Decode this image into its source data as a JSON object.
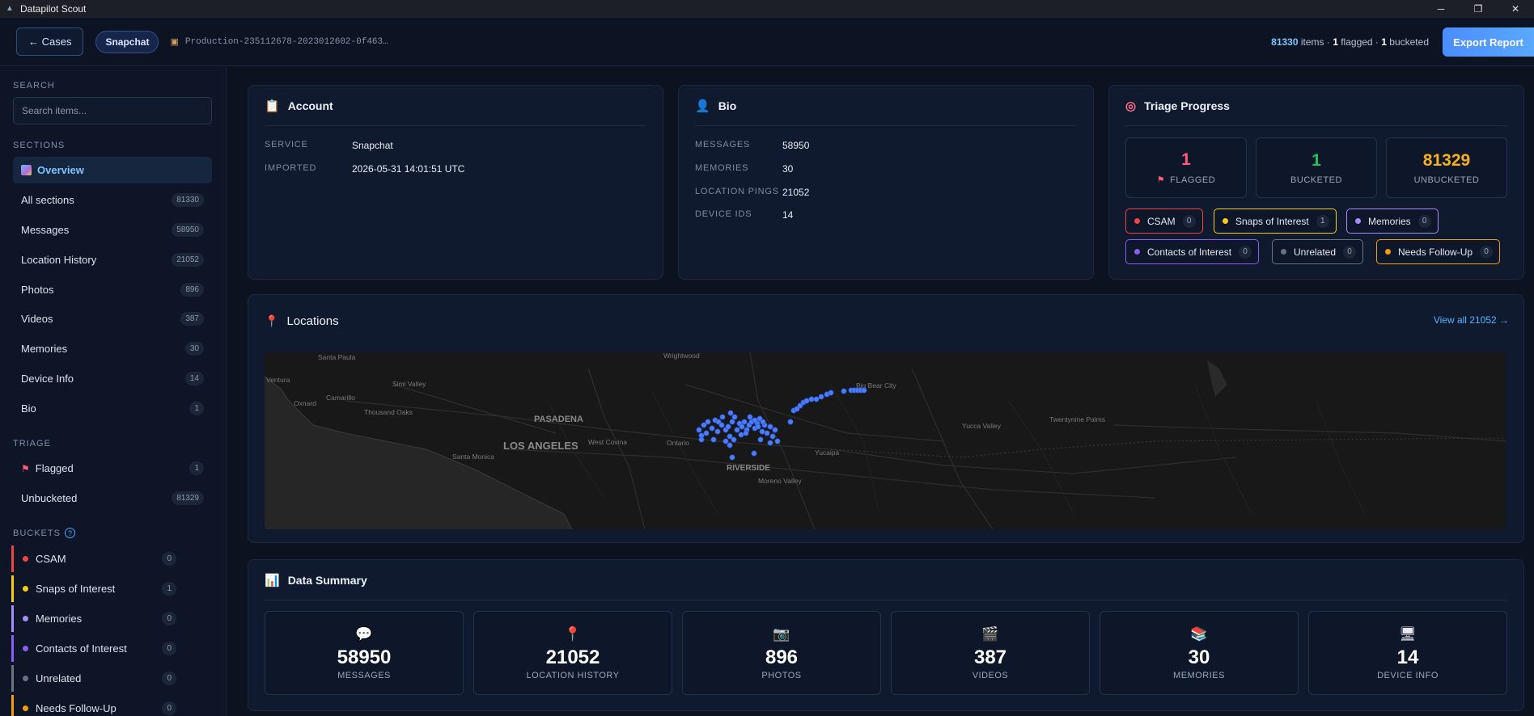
{
  "window": {
    "title": "Datapilot Scout"
  },
  "topbar": {
    "back_label": "← Cases",
    "service_chip": "Snapchat",
    "case_id": "Production-235112678-2023012602-0f463…",
    "items_count": "81330",
    "items_label": " items · ",
    "flagged_count": "1",
    "flagged_label": " flagged · ",
    "bucketed_count": "1",
    "bucketed_label": " bucketed",
    "export_label": "Export Report"
  },
  "sidebar": {
    "search_heading": "SEARCH",
    "search_placeholder": "Search items...",
    "sections_heading": "SECTIONS",
    "sections": [
      {
        "label": "Overview",
        "count": ""
      },
      {
        "label": "All sections",
        "count": "81330"
      },
      {
        "label": "Messages",
        "count": "58950"
      },
      {
        "label": "Location History",
        "count": "21052"
      },
      {
        "label": "Photos",
        "count": "896"
      },
      {
        "label": "Videos",
        "count": "387"
      },
      {
        "label": "Memories",
        "count": "30"
      },
      {
        "label": "Device Info",
        "count": "14"
      },
      {
        "label": "Bio",
        "count": "1"
      }
    ],
    "triage_heading": "TRIAGE",
    "triage": [
      {
        "label": "Flagged",
        "count": "1"
      },
      {
        "label": "Unbucketed",
        "count": "81329"
      }
    ],
    "buckets_heading": "BUCKETS",
    "buckets": [
      {
        "label": "CSAM",
        "count": "0",
        "color": "#ef4444"
      },
      {
        "label": "Snaps of Interest",
        "count": "1",
        "color": "#facc15"
      },
      {
        "label": "Memories",
        "count": "0",
        "color": "#a78bfa"
      },
      {
        "label": "Contacts of Interest",
        "count": "0",
        "color": "#8b5cf6"
      },
      {
        "label": "Unrelated",
        "count": "0",
        "color": "#6b7280"
      },
      {
        "label": "Needs Follow-Up",
        "count": "0",
        "color": "#f59e0b"
      }
    ]
  },
  "account": {
    "title": "Account",
    "rows": [
      {
        "key": "SERVICE",
        "value": "Snapchat"
      },
      {
        "key": "IMPORTED",
        "value": "2026-05-31 14:01:51 UTC"
      }
    ]
  },
  "bio": {
    "title": "Bio",
    "rows": [
      {
        "key": "MESSAGES",
        "value": "58950"
      },
      {
        "key": "MEMORIES",
        "value": "30"
      },
      {
        "key": "LOCATION PINGS",
        "value": "21052"
      },
      {
        "key": "DEVICE IDS",
        "value": "14"
      }
    ]
  },
  "triage_progress": {
    "title": "Triage Progress",
    "flagged": {
      "value": "1",
      "label": "FLAGGED",
      "color": "#ff5a78"
    },
    "bucketed": {
      "value": "1",
      "label": "BUCKETED",
      "color": "#22c55e"
    },
    "unbucketed": {
      "value": "81329",
      "label": "UNBUCKETED",
      "color": "#f5b21e"
    },
    "tags": [
      {
        "label": "CSAM",
        "count": "0",
        "color": "#ef4444"
      },
      {
        "label": "Snaps of Interest",
        "count": "1",
        "color": "#facc15"
      },
      {
        "label": "Memories",
        "count": "0",
        "color": "#a78bfa"
      },
      {
        "label": "Contacts of Interest",
        "count": "0",
        "color": "#8b5cf6"
      },
      {
        "label": "Unrelated",
        "count": "0",
        "color": "#6b7280"
      },
      {
        "label": "Needs Follow-Up",
        "count": "0",
        "color": "#f59e0b"
      }
    ]
  },
  "locations": {
    "title": "Locations",
    "view_all": "View all 21052 →",
    "map_labels": [
      "Santa Paula",
      "Wrightwood",
      "Ventura",
      "Simi Valley",
      "Oxnard",
      "Camarillo",
      "Thousand Oaks",
      "PASADENA",
      "LOS ANGELES",
      "West Covina",
      "Ontario",
      "Santa Monica",
      "RIVERSIDE",
      "Moreno Valley",
      "Yucaipa",
      "Big Bear City",
      "Yucca Valley",
      "Twentynine Palms"
    ]
  },
  "data_summary": {
    "title": "Data Summary",
    "items": [
      {
        "icon": "💬",
        "value": "58950",
        "label": "MESSAGES"
      },
      {
        "icon": "📍",
        "value": "21052",
        "label": "LOCATION HISTORY"
      },
      {
        "icon": "📷",
        "value": "896",
        "label": "PHOTOS"
      },
      {
        "icon": "🎬",
        "value": "387",
        "label": "VIDEOS"
      },
      {
        "icon": "📚",
        "value": "30",
        "label": "MEMORIES"
      },
      {
        "icon": "🖥",
        "value": "14",
        "label": "DEVICE INFO"
      }
    ]
  }
}
